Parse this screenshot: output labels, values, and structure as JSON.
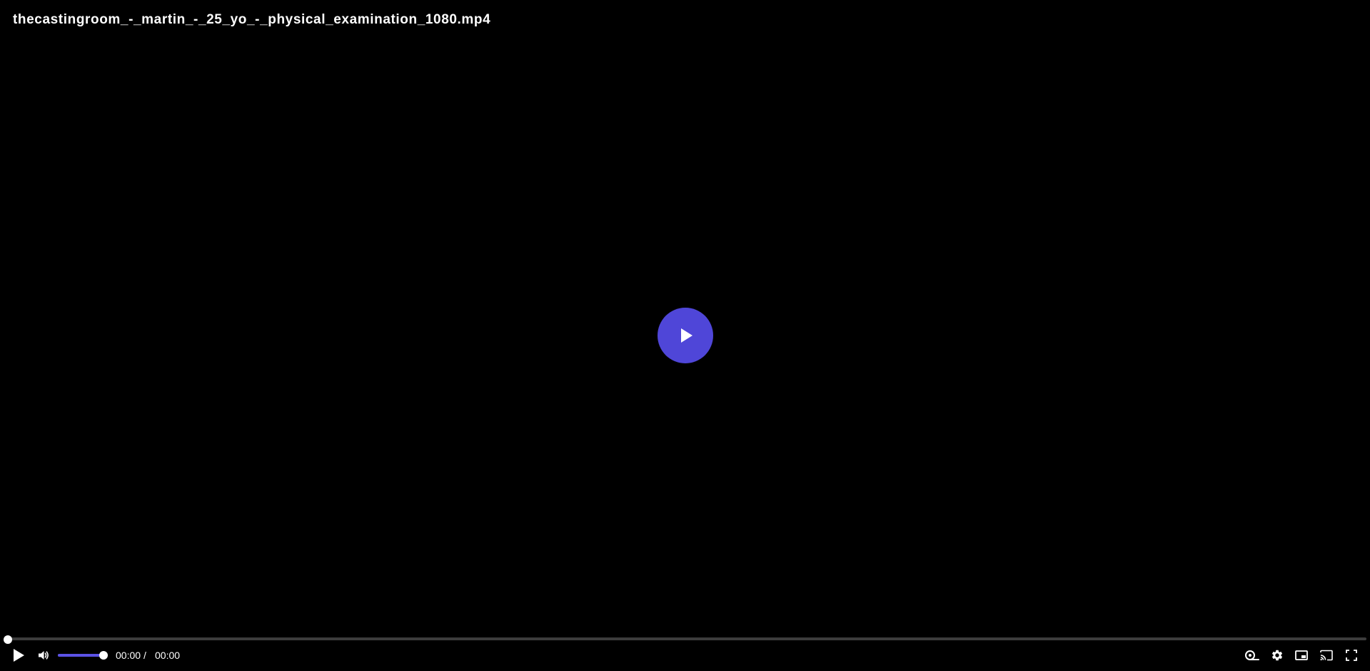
{
  "video": {
    "title": "thecastingroom_-_martin_-_25_yo_-_physical_examination_1080.mp4"
  },
  "player": {
    "current_time": "00:00",
    "time_separator": "/",
    "duration": "00:00",
    "progress": 0,
    "volume": 1,
    "colors": {
      "accent": "#4f46d8",
      "slider_fill": "#5b52e6",
      "track": "#3c3c3c",
      "background": "#000000",
      "foreground": "#ffffff"
    },
    "icons": {
      "big_play": "play-icon",
      "play": "play-icon",
      "volume": "volume-icon",
      "speed": "playback-speed-icon",
      "settings": "gear-icon",
      "pip": "picture-in-picture-icon",
      "cast": "cast-icon",
      "fullscreen": "fullscreen-icon"
    }
  }
}
